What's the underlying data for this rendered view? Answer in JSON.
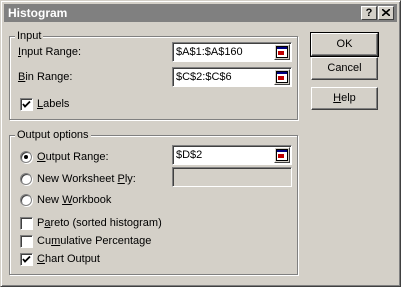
{
  "window": {
    "title": "Histogram",
    "help_button": "?",
    "close_button": "X"
  },
  "input_group": {
    "title": "Input",
    "input_range": {
      "label_key": "I",
      "label_rest": "nput Range:",
      "value": "$A$1:$A$160"
    },
    "bin_range": {
      "label_key": "B",
      "label_rest": "in Range:",
      "value": "$C$2:$C$6"
    },
    "labels": {
      "label_key": "L",
      "label_rest": "abels",
      "checked": true
    }
  },
  "output_group": {
    "title": "Output options",
    "output_range": {
      "label_key": "O",
      "label_rest": "utput Range:",
      "value": "$D$2",
      "selected": true
    },
    "new_worksheet": {
      "label_pre": "New Worksheet ",
      "label_key": "P",
      "label_rest": "ly:",
      "value": "",
      "selected": false
    },
    "new_workbook": {
      "label_pre": "New ",
      "label_key": "W",
      "label_rest": "orkbook",
      "selected": false
    },
    "pareto": {
      "label_pre": "P",
      "label_key": "a",
      "label_rest": "reto (sorted histogram)",
      "checked": false
    },
    "cumulative": {
      "label_pre": "Cu",
      "label_key": "m",
      "label_rest": "ulative Percentage",
      "checked": false
    },
    "chart_output": {
      "label_key": "C",
      "label_rest": "hart Output",
      "checked": true
    }
  },
  "buttons": {
    "ok": "OK",
    "cancel": "Cancel",
    "help_key": "H",
    "help_rest": "elp"
  },
  "colors": {
    "face": "#d4d0c8",
    "titlebar_inactive": "#808080"
  }
}
